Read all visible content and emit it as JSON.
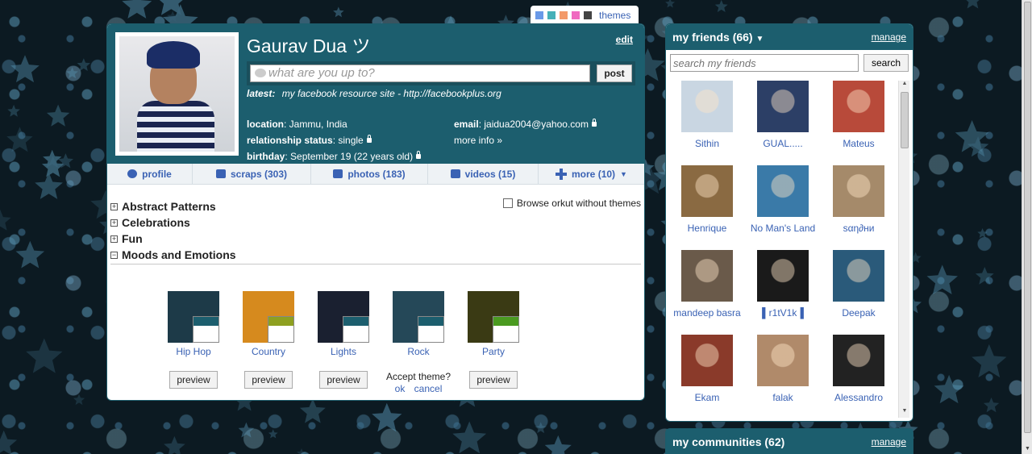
{
  "themes_bar": {
    "swatches": [
      "#6a9ae8",
      "#46b0b8",
      "#f39a6a",
      "#f06ac0",
      "#444444"
    ],
    "label": "themes"
  },
  "profile": {
    "name": "Gaurav Dua ツ",
    "edit_label": "edit",
    "status_placeholder": "what are you up to?",
    "post_label": "post",
    "latest_label": "latest:",
    "latest_text": "my facebook resource site - http://facebookplus.org",
    "location_label": "location",
    "location_value": ": Jammu, India",
    "relationship_label": "relationship status",
    "relationship_value": ": single",
    "birthday_label": "birthday",
    "birthday_value": ": September 19 (22 years old)",
    "email_label": "email",
    "email_value": ": jaidua2004@yahoo.com",
    "more_info": "more info »"
  },
  "tabs": [
    {
      "label": "profile"
    },
    {
      "label": "scraps (303)"
    },
    {
      "label": "photos (183)"
    },
    {
      "label": "videos (15)"
    },
    {
      "label": "more (10)"
    }
  ],
  "categories": [
    {
      "toggle": "+",
      "label": "Abstract Patterns"
    },
    {
      "toggle": "+",
      "label": "Celebrations"
    },
    {
      "toggle": "+",
      "label": "Fun"
    },
    {
      "toggle": "−",
      "label": "Moods and Emotions"
    }
  ],
  "browse_label": "Browse orkut without themes",
  "themes": [
    {
      "name": "Hip Hop",
      "button": "preview",
      "bg": "#1d3a48",
      "accent": "#1c5e6e"
    },
    {
      "name": "Country",
      "button": "preview",
      "bg": "#d68a1e",
      "accent": "#8ea020"
    },
    {
      "name": "Lights",
      "button": "preview",
      "bg": "#1a2030",
      "accent": "#1c5e6e"
    },
    {
      "name": "Rock",
      "button": "",
      "bg": "#254858",
      "accent": "#1c5e6e"
    },
    {
      "name": "Party",
      "button": "preview",
      "bg": "#3a3a14",
      "accent": "#4a9a20"
    }
  ],
  "accept_prompt": "Accept theme?",
  "accept_ok": "ok",
  "accept_cancel": "cancel",
  "friends": {
    "title": "my friends (66)",
    "manage": "manage",
    "search_placeholder": "search my friends",
    "search_button": "search",
    "list": [
      {
        "name": "Sithin",
        "color": "#c9d6e2"
      },
      {
        "name": "GUAL.....",
        "color": "#2c3f66"
      },
      {
        "name": "Mateus",
        "color": "#b84a3a"
      },
      {
        "name": "Henrique",
        "color": "#8a6a42"
      },
      {
        "name": "No Man's Land",
        "color": "#3a7aa8"
      },
      {
        "name": "ѕαη∂ни",
        "color": "#a58a6a"
      },
      {
        "name": "mandeep basra",
        "color": "#6a5a4a"
      },
      {
        "name": "▌r1tV1k▐",
        "color": "#1a1a1a"
      },
      {
        "name": "Deepak",
        "color": "#2a5a7a"
      },
      {
        "name": "Ekam",
        "color": "#8a3a2a"
      },
      {
        "name": "falak",
        "color": "#b08a6a"
      },
      {
        "name": "Alessandro",
        "color": "#222222"
      }
    ]
  },
  "communities": {
    "title": "my communities (62)",
    "manage": "manage"
  }
}
